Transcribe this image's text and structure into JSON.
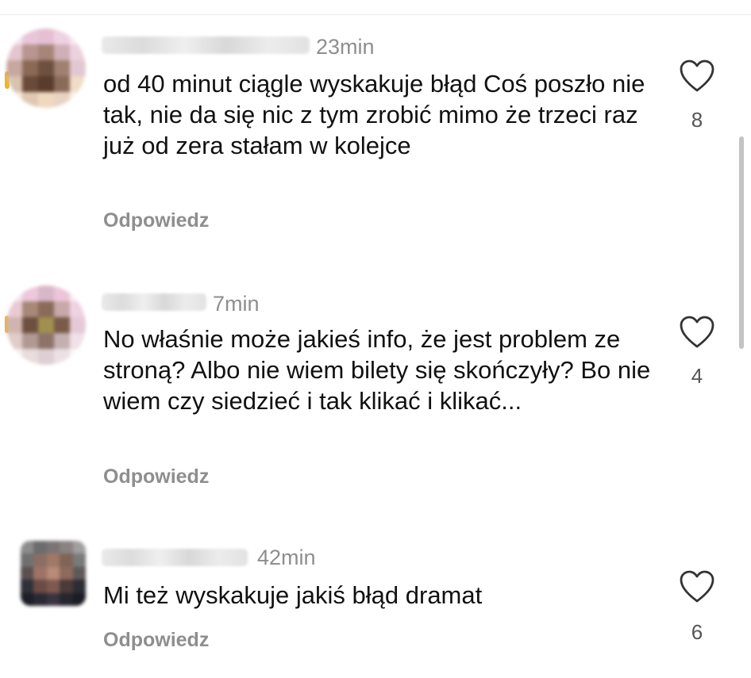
{
  "comments": [
    {
      "time": "23min",
      "text": "od 40 minut ciągle wyskakuje błąd Coś poszło nie tak, nie da się nic z tym zrobić mimo że trzeci raz już od zera stałam w kolejce",
      "reply_label": "Odpowiedz",
      "likes": "8"
    },
    {
      "time": "7min",
      "text": "No właśnie może jakieś info, że jest problem ze stroną? Albo nie wiem bilety się skończyły? Bo nie wiem czy siedzieć i tak klikać i klikać...",
      "reply_label": "Odpowiedz",
      "likes": "4"
    },
    {
      "time": "42min",
      "text": "Mi też wyskakuje jakiś błąd dramat",
      "reply_label": "Odpowiedz",
      "likes": "6"
    }
  ],
  "icons": {
    "like": "heart-outline-icon"
  },
  "colors": {
    "secondary_text": "#8e8e8e",
    "primary_text": "#111111",
    "story_ring": "#f0b428"
  }
}
